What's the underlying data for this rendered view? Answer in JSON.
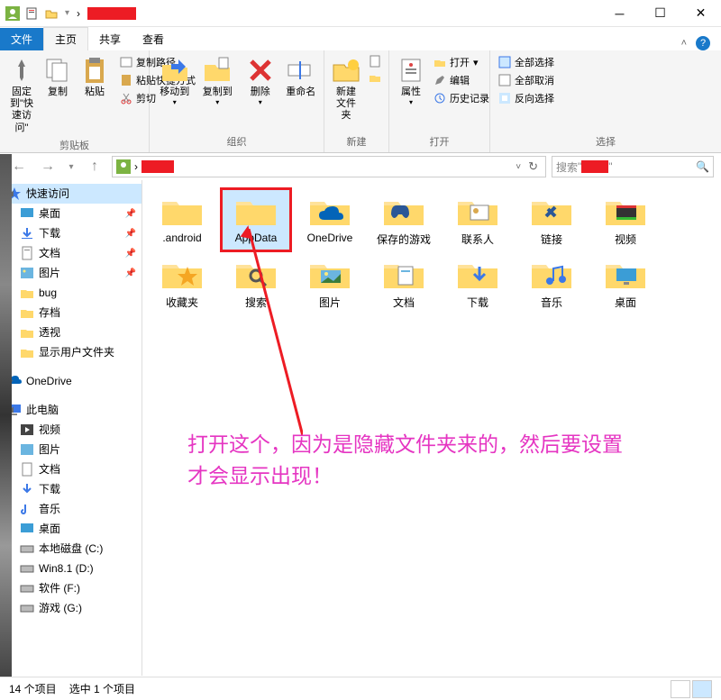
{
  "titlebar": {
    "separator": "›"
  },
  "tabs": {
    "file": "文件",
    "home": "主页",
    "share": "共享",
    "view": "查看"
  },
  "ribbon": {
    "clipboard": {
      "label": "剪贴板",
      "pin": "固定到\"快速访问\"",
      "copy": "复制",
      "paste": "粘贴",
      "copy_path": "复制路径",
      "paste_shortcut": "粘贴快捷方式",
      "cut": "剪切"
    },
    "organize": {
      "label": "组织",
      "move_to": "移动到",
      "copy_to": "复制到",
      "delete": "删除",
      "rename": "重命名"
    },
    "new": {
      "label": "新建",
      "new_folder": "新建文件夹"
    },
    "open": {
      "label": "打开",
      "properties": "属性",
      "open": "打开",
      "edit": "编辑",
      "history": "历史记录"
    },
    "select": {
      "label": "选择",
      "select_all": "全部选择",
      "select_none": "全部取消",
      "invert": "反向选择"
    }
  },
  "search": {
    "placeholder_prefix": "搜索"
  },
  "sidebar": {
    "quick_access": "快速访问",
    "items_qa": [
      "桌面",
      "下载",
      "文档",
      "图片",
      "bug",
      "存档",
      "透视",
      "显示用户文件夹"
    ],
    "onedrive": "OneDrive",
    "this_pc": "此电脑",
    "items_pc": [
      "视频",
      "图片",
      "文档",
      "下载",
      "音乐",
      "桌面",
      "本地磁盘 (C:)",
      "Win8.1 (D:)",
      "软件 (F:)",
      "游戏 (G:)"
    ]
  },
  "folders": [
    ".android",
    "AppData",
    "OneDrive",
    "保存的游戏",
    "联系人",
    "链接",
    "视频",
    "收藏夹",
    "搜索",
    "图片",
    "文档",
    "下载",
    "音乐",
    "桌面"
  ],
  "annotation": "打开这个，因为是隐藏文件夹来的，然后要设置才会显示出现！",
  "statusbar": {
    "count": "14 个项目",
    "selected": "选中 1 个项目"
  }
}
